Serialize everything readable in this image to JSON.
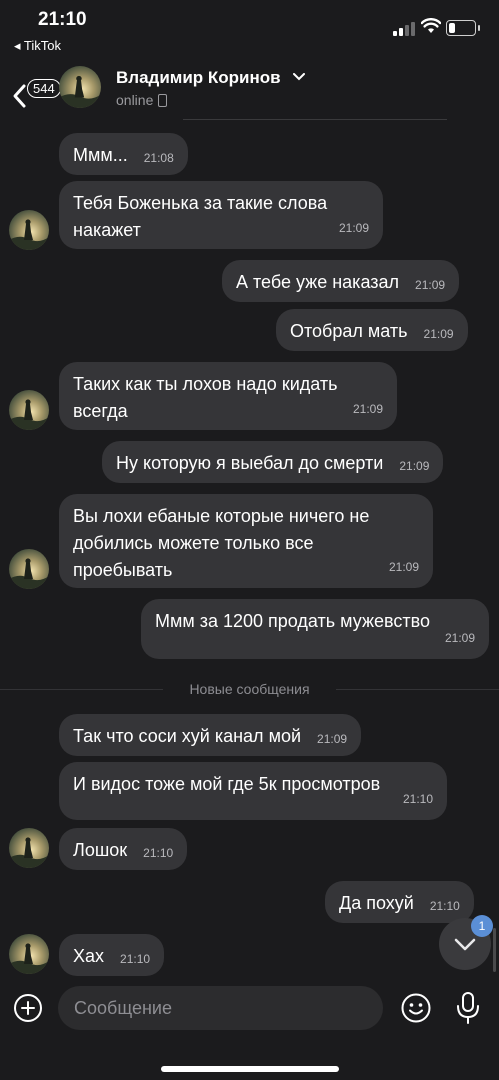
{
  "status_bar": {
    "time": "21:10",
    "back_app": "◂ TikTok"
  },
  "header": {
    "unread_count": "544",
    "contact_name": "Владимир Коринов",
    "presence": "online"
  },
  "messages": [
    {
      "side": "in",
      "text": "Ммм...",
      "time": "21:08"
    },
    {
      "side": "in",
      "text": "Тебя Боженька за такие слова\nнакажет",
      "time": "21:09"
    },
    {
      "side": "out",
      "text": "А тебе уже наказал",
      "time": "21:09"
    },
    {
      "side": "out",
      "text": "Отобрал мать",
      "time": "21:09"
    },
    {
      "side": "in",
      "text": "Таких как ты лохов надо кидать\nвсегда",
      "time": "21:09"
    },
    {
      "side": "out",
      "text": "Ну которую я выебал до смерти",
      "time": "21:09"
    },
    {
      "side": "in",
      "text": "Вы лохи ебаные которые ничего не\nдобились можете только все\nпроебывать",
      "time": "21:09"
    },
    {
      "side": "out",
      "text": "Ммм за 1200 продать мужевство",
      "time": "21:09"
    },
    {
      "side": "in",
      "text": "Так что соси хуй канал мой",
      "time": "21:09"
    },
    {
      "side": "in",
      "text": "И видос тоже мой где 5к просмотров",
      "time": "21:10"
    },
    {
      "side": "in",
      "text": "Лошок",
      "time": "21:10"
    },
    {
      "side": "out",
      "text": "Да похуй",
      "time": "21:10"
    },
    {
      "side": "in",
      "text": "Хах",
      "time": "21:10"
    }
  ],
  "divider_label": "Новые сообщения",
  "scroll_badge": "1",
  "composer": {
    "placeholder": "Сообщение"
  },
  "icons": [
    "back-arrow-icon",
    "chevron-down-icon",
    "phone-icon",
    "add-icon",
    "emoji-icon",
    "microphone-icon",
    "arrow-down-icon"
  ],
  "colors": {
    "background": "#1b1b1d",
    "bubble": "#353538",
    "badge": "#5b8fd6"
  }
}
